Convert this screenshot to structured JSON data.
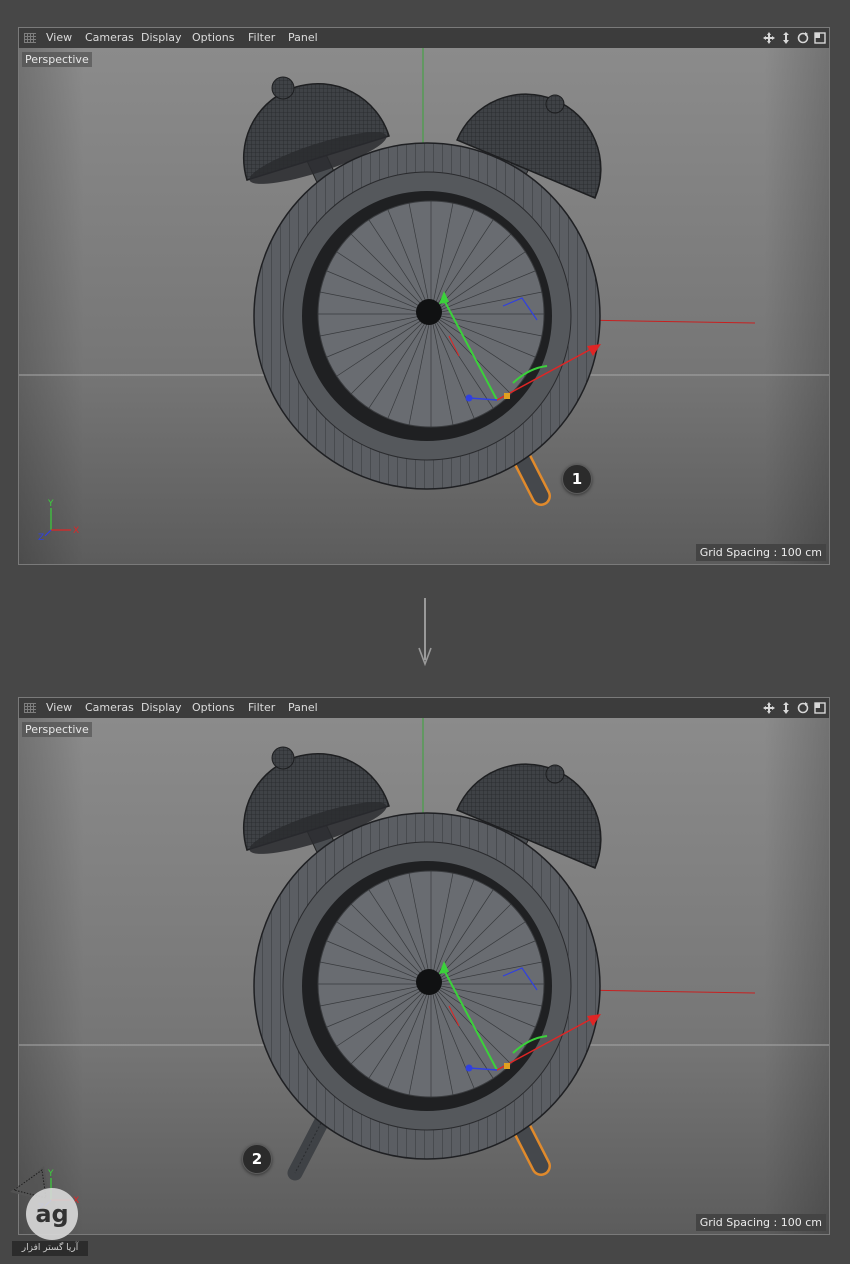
{
  "menu": {
    "items": [
      "View",
      "Cameras",
      "Display",
      "Options",
      "Filter",
      "Panel"
    ]
  },
  "nav_icons": [
    "move-icon",
    "zoom-icon",
    "rotate-icon",
    "maximize-icon"
  ],
  "viewports": [
    {
      "label": "Perspective",
      "grid_spacing": "Grid Spacing : 100 cm",
      "callout": "1",
      "axis_labels": {
        "x": "X",
        "y": "Y",
        "z": "Z"
      },
      "legs": [
        "right"
      ]
    },
    {
      "label": "Perspective",
      "grid_spacing": "Grid Spacing : 100 cm",
      "callout": "2",
      "axis_labels": {
        "x": "X",
        "y": "Y",
        "z": "Z"
      },
      "legs": [
        "left",
        "right"
      ]
    }
  ],
  "watermark": {
    "text": "آریا گستر افزار"
  },
  "colors": {
    "background": "#474747",
    "viewport_top": "#8a8a8a",
    "viewport_bottom": "#5e5e5e",
    "clock_body": "#5a5d62",
    "selection_outline": "#e08a2c",
    "axis_x": "#e02020",
    "axis_y": "#20c020",
    "axis_z": "#3040e0"
  }
}
